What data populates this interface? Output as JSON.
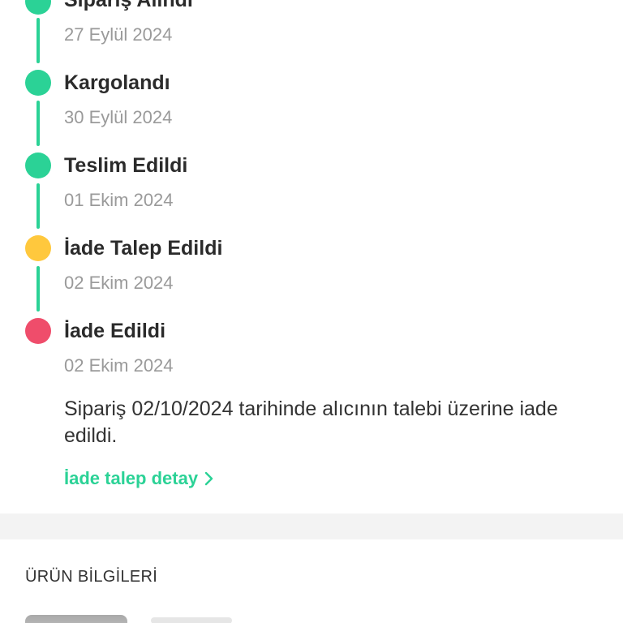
{
  "colors": {
    "green": "#2bd296",
    "yellow": "#ffc83d",
    "red": "#ef4d6b"
  },
  "timeline": [
    {
      "title": "Sipariş Alındı",
      "date": "27 Eylül 2024",
      "status": "green"
    },
    {
      "title": "Kargolandı",
      "date": "30 Eylül 2024",
      "status": "green"
    },
    {
      "title": "Teslim Edildi",
      "date": "01 Ekim 2024",
      "status": "green"
    },
    {
      "title": "İade Talep Edildi",
      "date": "02 Ekim 2024",
      "status": "yellow"
    },
    {
      "title": "İade Edildi",
      "date": "02 Ekim 2024",
      "status": "red"
    }
  ],
  "description": "Sipariş 02/10/2024 tarihinde alıcının talebi üzerine iade edildi.",
  "return_link": {
    "label": "İade talep detay",
    "icon": "chevron-right-icon"
  },
  "product_section": {
    "title": "ÜRÜN BİLGİLERİ"
  }
}
